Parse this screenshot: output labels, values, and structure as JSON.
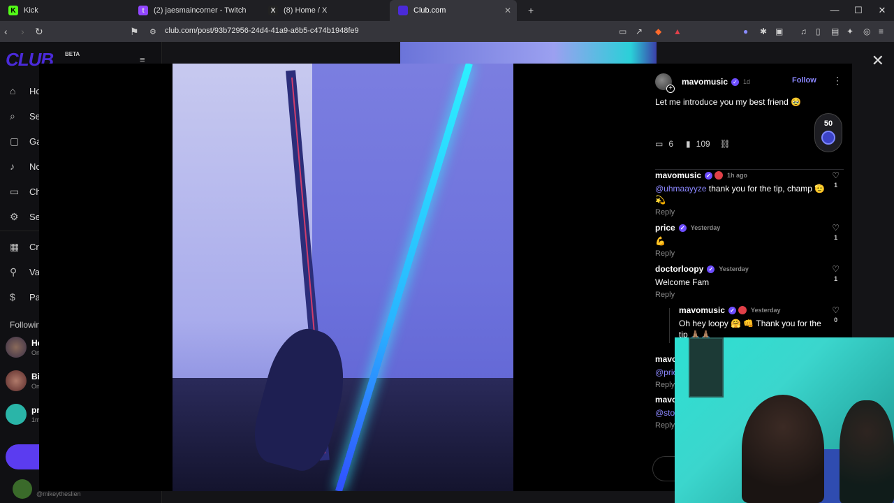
{
  "browser": {
    "tabs": [
      {
        "title": "Kick",
        "active": false,
        "color": "#53fc18",
        "glyph": "K"
      },
      {
        "title": "(2) jaesmaincorner - Twitch",
        "active": false,
        "color": "#9146ff",
        "glyph": "t"
      },
      {
        "title": "(8) Home / X",
        "active": false,
        "color": "#222222",
        "glyph": "X"
      },
      {
        "title": "Club.com",
        "active": true,
        "color": "#4a2ad9",
        "glyph": ""
      }
    ],
    "url": "club.com/post/93b72956-24d4-41a9-a6b5-c474b1948fe9"
  },
  "sidebar": {
    "logo": "CLUB",
    "beta": "BETA",
    "items": [
      {
        "label": "Ho",
        "icon": "home-icon"
      },
      {
        "label": "Se",
        "icon": "search-icon"
      },
      {
        "label": "Ga",
        "icon": "gallery-icon"
      },
      {
        "label": "No",
        "icon": "bell-icon"
      },
      {
        "label": "Ch",
        "icon": "chat-icon"
      },
      {
        "label": "Se",
        "icon": "gear-icon"
      },
      {
        "label": "Cr",
        "icon": "grid-icon"
      },
      {
        "label": "Va",
        "icon": "vault-icon"
      },
      {
        "label": "Pa",
        "icon": "dollar-icon"
      }
    ],
    "following_heading": "Followin",
    "following": [
      {
        "name": "He",
        "status": "On"
      },
      {
        "name": "Bi",
        "status": "On"
      },
      {
        "name": "pr",
        "status": "1m"
      }
    ],
    "me_handle": "@mikeytheslien"
  },
  "post": {
    "author": "mavomusic",
    "age": "1d",
    "follow_label": "Follow",
    "caption": "Let me introduce you my best friend 🥹",
    "comment_count": "6",
    "view_count": "109",
    "badge_value": "50"
  },
  "comments": [
    {
      "user": "mavomusic",
      "time": "1h ago",
      "mention": "@uhmaayyze",
      "text": " thank you for the tip, champ 🫡 💫",
      "likes": "1",
      "reply": "Reply"
    },
    {
      "user": "price",
      "time": "Yesterday",
      "mention": "",
      "text": "💪",
      "likes": "1",
      "reply": "Reply"
    },
    {
      "user": "doctorloopy",
      "time": "Yesterday",
      "mention": "",
      "text": "Welcome Fam",
      "likes": "1",
      "reply": "Reply"
    },
    {
      "user": "mavomusic",
      "time": "Yesterday",
      "mention": "",
      "text": "Oh hey loopy 🤗 👊 Thank you for the tip 🙏🏽🙏🏽",
      "likes": "0",
      "reply": ""
    },
    {
      "user": "mavo",
      "time": "",
      "mention": "@pric",
      "text": "",
      "likes": "",
      "reply": "Reply"
    },
    {
      "user": "mavo",
      "time": "",
      "mention": "@stoc",
      "text": "",
      "likes": "",
      "reply": "Reply"
    }
  ],
  "webcam": {
    "label": "webcam-overlay"
  }
}
